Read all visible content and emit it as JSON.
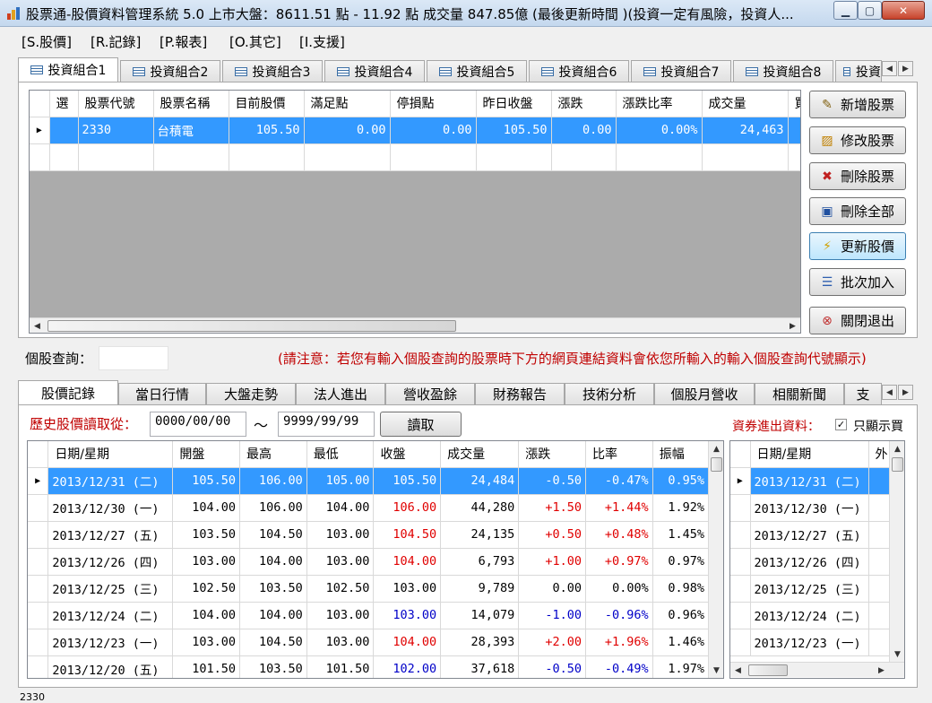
{
  "window": {
    "title": "股票通-股價資料管理系統 5.0 上市大盤：8611.51 點  - 11.92 點 成交量 847.85億 (最後更新時間 )(投資一定有風險，投資人..."
  },
  "menu": [
    "[S.股價]",
    "[R.記錄]",
    "[P.報表]",
    "[O.其它]",
    "[I.支援]"
  ],
  "portfolio_tabs": [
    "投資組合1",
    "投資組合2",
    "投資組合3",
    "投資組合4",
    "投資組合5",
    "投資組合6",
    "投資組合7",
    "投資組合8",
    "投資"
  ],
  "portfolio_grid": {
    "headers": [
      "選",
      "股票代號",
      "股票名稱",
      "目前股價",
      "滿足點",
      "停損點",
      "昨日收盤",
      "漲跌",
      "漲跌比率",
      "成交量",
      "買"
    ],
    "rows": [
      [
        "",
        "2330",
        "台積電",
        "105.50",
        "0.00",
        "0.00",
        "105.50",
        "0.00",
        "0.00%",
        "24,463",
        ""
      ]
    ]
  },
  "buttons": {
    "add": "新增股票",
    "edit": "修改股票",
    "delete": "刪除股票",
    "delete_all": "刪除全部",
    "update": "更新股價",
    "batch": "批次加入",
    "close": "關閉退出"
  },
  "query": {
    "label": "個股查詢：",
    "value": "",
    "notice": "(請注意：若您有輸入個股查詢的股票時下方的網頁連結資料會依您所輸入的輸入個股查詢代號顯示)"
  },
  "detail_tabs": [
    "股價記錄",
    "當日行情",
    "大盤走勢",
    "法人進出",
    "營收盈餘",
    "財務報告",
    "技術分析",
    "個股月營收",
    "相關新聞",
    "支"
  ],
  "history": {
    "label": "歷史股價讀取從：",
    "from": "0000/00/00",
    "tilde": "～",
    "to": "9999/99/99",
    "read_button": "讀取",
    "margin_label": "資券進出資料：",
    "only_show_label": "只顯示買"
  },
  "history_grid": {
    "headers": [
      "日期/星期",
      "開盤",
      "最高",
      "最低",
      "收盤",
      "成交量",
      "漲跌",
      "比率",
      "振幅"
    ],
    "rows": [
      {
        "date": "2013/12/31 (二)",
        "open": "105.50",
        "high": "106.00",
        "low": "105.00",
        "close": "105.50",
        "vol": "24,484",
        "chg": "-0.50",
        "pct": "-0.47%",
        "amp": "0.95%",
        "close_c": "",
        "chg_c": "blue"
      },
      {
        "date": "2013/12/30 (一)",
        "open": "104.00",
        "high": "106.00",
        "low": "104.00",
        "close": "106.00",
        "vol": "44,280",
        "chg": "+1.50",
        "pct": "+1.44%",
        "amp": "1.92%",
        "close_c": "red",
        "chg_c": "red"
      },
      {
        "date": "2013/12/27 (五)",
        "open": "103.50",
        "high": "104.50",
        "low": "103.00",
        "close": "104.50",
        "vol": "24,135",
        "chg": "+0.50",
        "pct": "+0.48%",
        "amp": "1.45%",
        "close_c": "red",
        "chg_c": "red"
      },
      {
        "date": "2013/12/26 (四)",
        "open": "103.00",
        "high": "104.00",
        "low": "103.00",
        "close": "104.00",
        "vol": "6,793",
        "chg": "+1.00",
        "pct": "+0.97%",
        "amp": "0.97%",
        "close_c": "red",
        "chg_c": "red"
      },
      {
        "date": "2013/12/25 (三)",
        "open": "102.50",
        "high": "103.50",
        "low": "102.50",
        "close": "103.00",
        "vol": "9,789",
        "chg": "0.00",
        "pct": "0.00%",
        "amp": "0.98%",
        "close_c": "",
        "chg_c": ""
      },
      {
        "date": "2013/12/24 (二)",
        "open": "104.00",
        "high": "104.00",
        "low": "103.00",
        "close": "103.00",
        "vol": "14,079",
        "chg": "-1.00",
        "pct": "-0.96%",
        "amp": "0.96%",
        "close_c": "blue",
        "chg_c": "blue"
      },
      {
        "date": "2013/12/23 (一)",
        "open": "103.00",
        "high": "104.50",
        "low": "103.00",
        "close": "104.00",
        "vol": "28,393",
        "chg": "+2.00",
        "pct": "+1.96%",
        "amp": "1.46%",
        "close_c": "red",
        "chg_c": "red"
      },
      {
        "date": "2013/12/20 (五)",
        "open": "101.50",
        "high": "103.50",
        "low": "101.50",
        "close": "102.00",
        "vol": "37,618",
        "chg": "-0.50",
        "pct": "-0.49%",
        "amp": "1.97%",
        "close_c": "blue",
        "chg_c": "blue"
      }
    ]
  },
  "margin_grid": {
    "headers": [
      "日期/星期",
      "外"
    ],
    "rows": [
      "2013/12/31 (二)",
      "2013/12/30 (一)",
      "2013/12/27 (五)",
      "2013/12/26 (四)",
      "2013/12/25 (三)",
      "2013/12/24 (二)",
      "2013/12/23 (一)"
    ]
  },
  "status": {
    "text": "2330"
  },
  "colors": {
    "selection": "#3399ff",
    "up": "#e00000",
    "down": "#0000c8",
    "notice": "#c00000"
  }
}
